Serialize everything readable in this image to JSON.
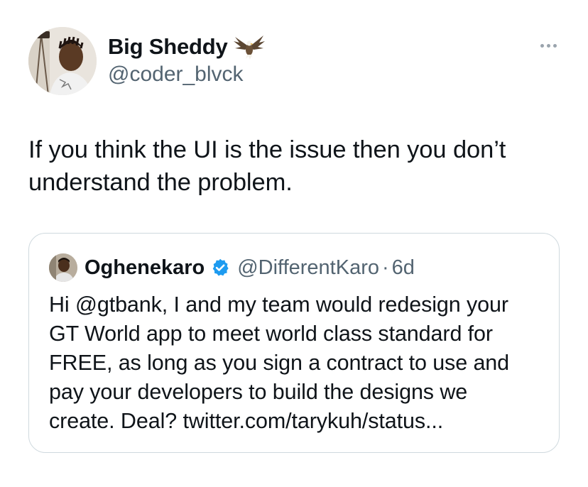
{
  "tweet": {
    "author": {
      "display_name": "Big Sheddy",
      "name_emoji_icon": "eagle-icon",
      "handle": "@coder_blvck",
      "avatar_icon": "profile-photo"
    },
    "more_icon": "more-horizontal-icon",
    "text": "If you think the UI is the issue then you don’t understand the problem.",
    "text_lines": [
      "If you think the UI is the issue then you don’t",
      "understand the problem."
    ]
  },
  "quote": {
    "author": {
      "display_name": "Oghenekaro",
      "verified_icon": "verified-badge-icon",
      "verified_color": "#1d9bf0",
      "handle": "@DifferentKaro",
      "separator": "·",
      "time": "6d"
    },
    "text_lines": [
      "Hi @gtbank, I and my team would redesign your",
      "GT World app to meet world class standard for",
      "FREE, as long as you sign a contract to use and",
      "pay your developers to build the designs we",
      "create. Deal? twitter.com/tarykuh/status..."
    ]
  },
  "colors": {
    "text_primary": "#0f1419",
    "text_secondary": "#536471",
    "border": "#cfd9de",
    "background": "#ffffff"
  }
}
